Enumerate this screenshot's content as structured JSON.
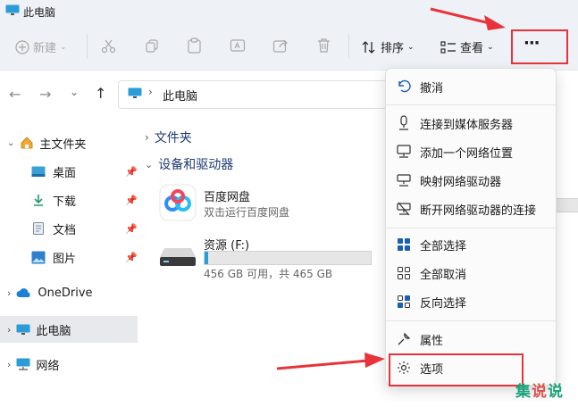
{
  "window": {
    "title": "此电脑"
  },
  "toolbar": {
    "new_label": "新建",
    "sort_label": "排序",
    "view_label": "查看",
    "more_label": "···"
  },
  "address": {
    "path": "此电脑"
  },
  "sidebar": {
    "items": [
      {
        "label": "主文件夹"
      },
      {
        "label": "桌面"
      },
      {
        "label": "下载"
      },
      {
        "label": "文档"
      },
      {
        "label": "图片"
      },
      {
        "label": "OneDrive"
      },
      {
        "label": "此电脑"
      },
      {
        "label": "网络"
      }
    ]
  },
  "main": {
    "folders_header": "文件夹",
    "drives_header": "设备和驱动器",
    "baidu": {
      "name": "百度网盘",
      "desc": "双击运行百度网盘"
    },
    "drive": {
      "name": "资源 (F:)",
      "detail": "456 GB 可用，共 465 GB",
      "used_fraction": 0.02
    }
  },
  "menu": {
    "items": [
      {
        "label": "撤消"
      },
      {
        "label": "连接到媒体服务器"
      },
      {
        "label": "添加一个网络位置"
      },
      {
        "label": "映射网络驱动器"
      },
      {
        "label": "断开网络驱动器的连接"
      },
      {
        "label": "全部选择"
      },
      {
        "label": "全部取消"
      },
      {
        "label": "反向选择"
      },
      {
        "label": "属性"
      },
      {
        "label": "选项"
      }
    ]
  },
  "watermark": {
    "chars": [
      "集",
      "说",
      "说"
    ]
  },
  "colors": {
    "accent": "#0067c0",
    "highlight": "#e8333a",
    "watermark": "#1aa37a"
  }
}
